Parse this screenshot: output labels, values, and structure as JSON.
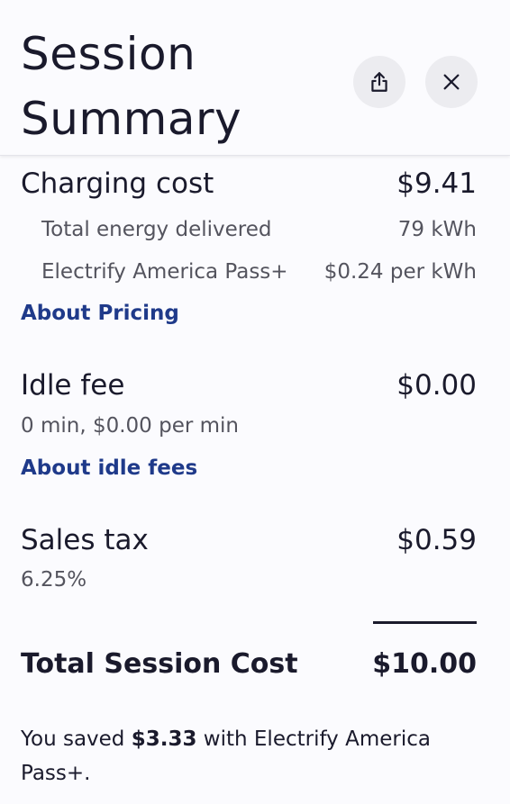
{
  "header": {
    "title": "Session Summary",
    "share_icon": "share-icon",
    "close_icon": "close-icon"
  },
  "charging": {
    "label": "Charging cost",
    "value": "$9.41",
    "energy_label": "Total energy delivered",
    "energy_value": "79 kWh",
    "plan_label": "Electrify America Pass+",
    "plan_value": "$0.24 per kWh",
    "link": "About Pricing"
  },
  "idle": {
    "label": "Idle fee",
    "value": "$0.00",
    "detail": "0 min, $0.00 per min",
    "link": "About idle fees"
  },
  "tax": {
    "label": "Sales tax",
    "value": "$0.59",
    "detail": "6.25%"
  },
  "total": {
    "label": "Total Session Cost",
    "value": "$10.00"
  },
  "savings": {
    "prefix": "You saved ",
    "amount": "$3.33",
    "suffix": " with Electrify America Pass+."
  }
}
